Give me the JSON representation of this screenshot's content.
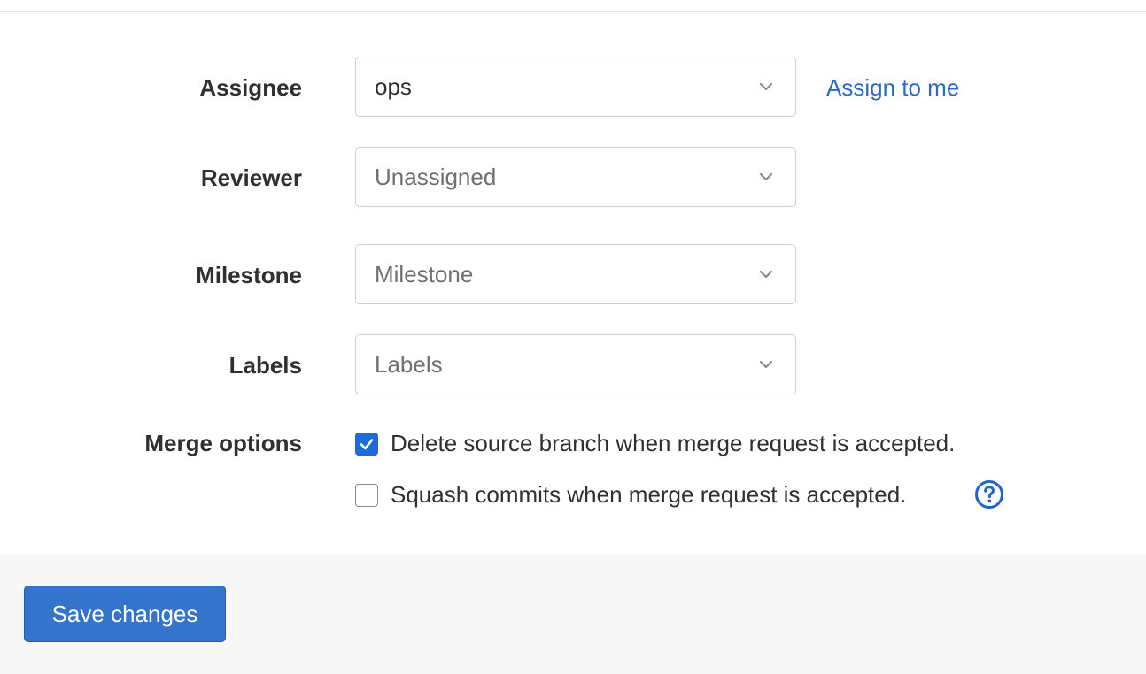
{
  "form": {
    "assignee": {
      "label": "Assignee",
      "value": "ops",
      "assign_to_me_label": "Assign to me"
    },
    "reviewer": {
      "label": "Reviewer",
      "placeholder": "Unassigned"
    },
    "milestone": {
      "label": "Milestone",
      "placeholder": "Milestone"
    },
    "labels": {
      "label": "Labels",
      "placeholder": "Labels"
    },
    "merge_options": {
      "label": "Merge options",
      "options": [
        {
          "label": "Delete source branch when merge request is accepted.",
          "checked": true
        },
        {
          "label": "Squash commits when merge request is accepted.",
          "checked": false
        }
      ]
    }
  },
  "footer": {
    "save_label": "Save changes"
  },
  "colors": {
    "link": "#2e69c3",
    "primary_button": "#3474cc",
    "checkbox_checked": "#1a6dd8",
    "footer_bg": "#f7f7f7"
  },
  "icons": {
    "dropdown": "chevron-down-icon",
    "help": "question-circle-icon",
    "checkmark": "checkmark-icon"
  }
}
